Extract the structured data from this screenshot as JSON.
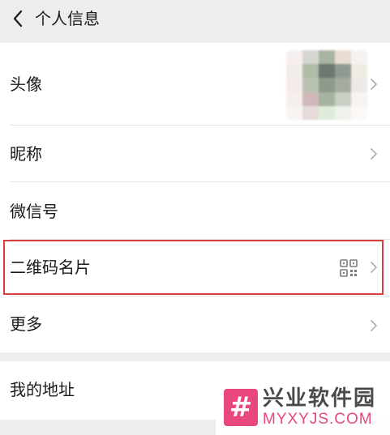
{
  "header": {
    "title": "个人信息",
    "back_icon": "chevron-left-icon"
  },
  "rows": {
    "avatar": {
      "label": "头像",
      "icon": "chevron-right-icon"
    },
    "nickname": {
      "label": "昵称",
      "icon": "chevron-right-icon"
    },
    "wechat_id": {
      "label": "微信号"
    },
    "qr_card": {
      "label": "二维码名片",
      "icon": "qr-code-icon"
    },
    "more": {
      "label": "更多",
      "icon": "chevron-right-icon"
    },
    "address": {
      "label": "我的地址"
    }
  },
  "highlight_color": "#dc3e3e",
  "watermark": {
    "logo_glyph": "#",
    "name": "兴业软件园",
    "site": "MYXYJS.COM",
    "color": "#e8477f"
  },
  "colors": {
    "background": "#ededed",
    "card": "#ffffff",
    "text": "#1a1a1a",
    "chevron": "#b2b2b2"
  }
}
